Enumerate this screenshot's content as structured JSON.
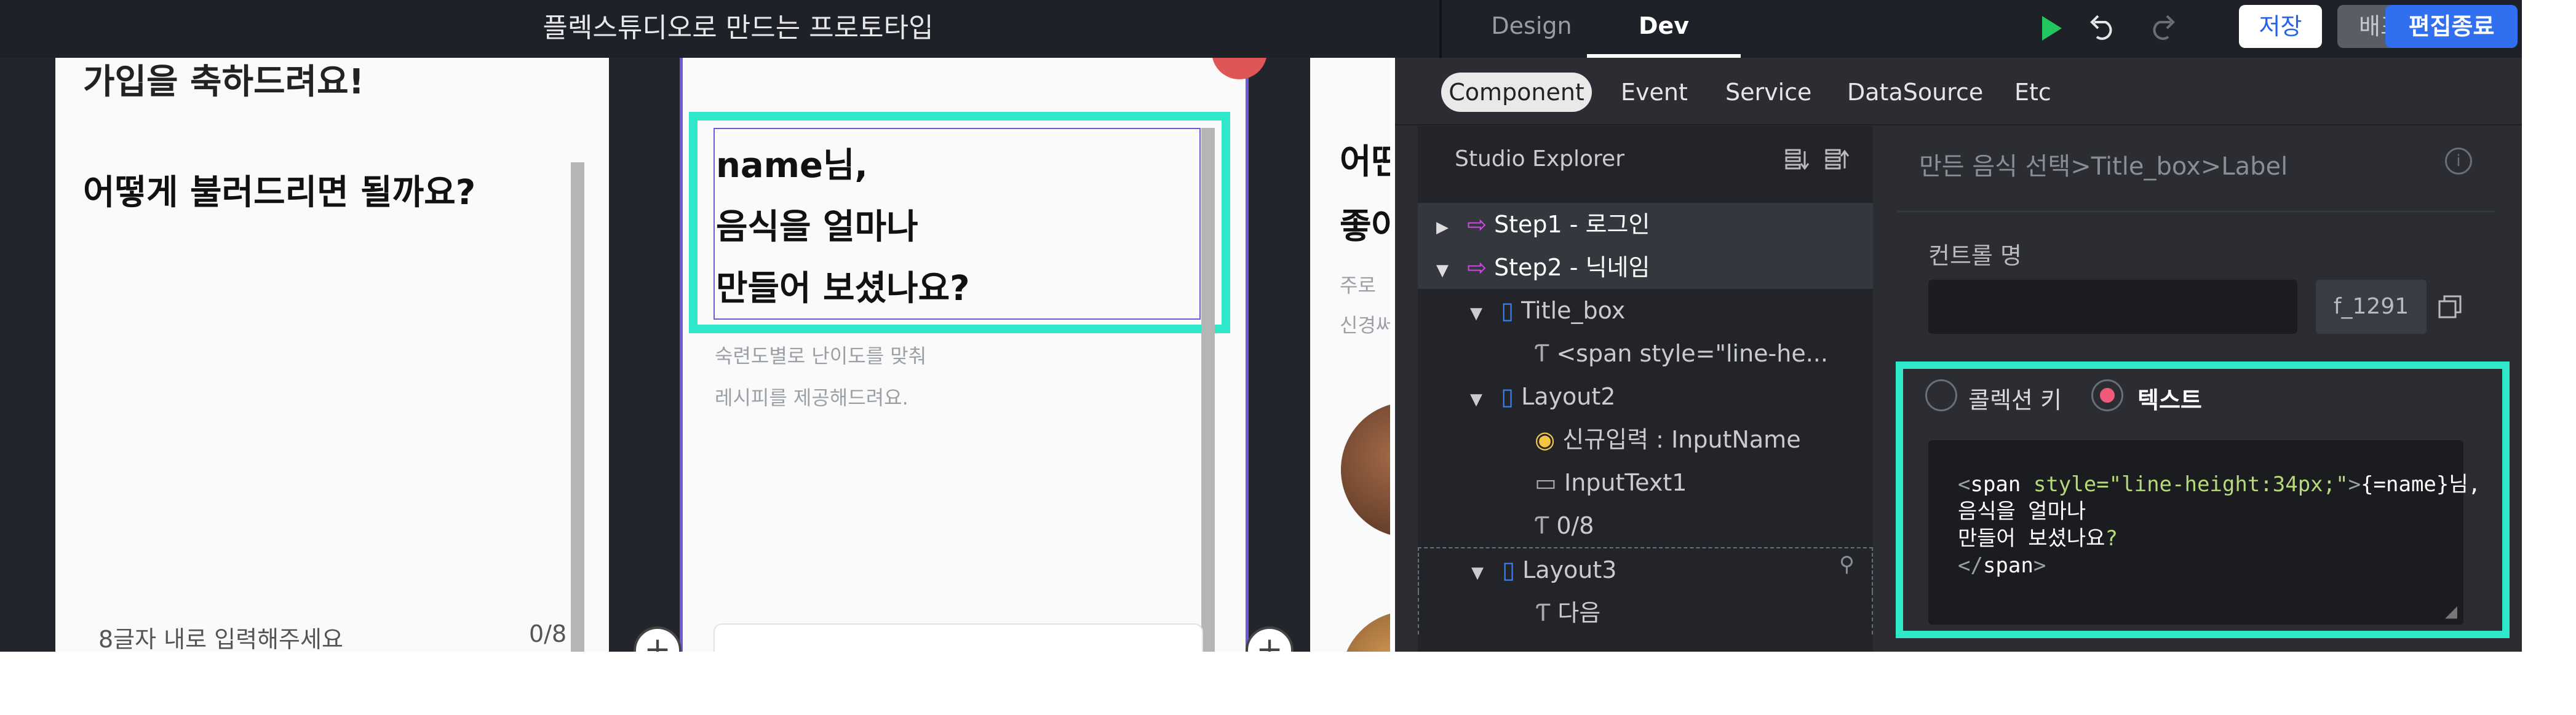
{
  "app": {
    "title": "플렉스튜디오로 만드는 프로토타입",
    "tabs": [
      "Design",
      "Dev"
    ],
    "active_tab": "Dev",
    "buttons": {
      "save": "저장",
      "deploy": "배포",
      "end_edit": "편집종료"
    }
  },
  "canvas": {
    "screen1": {
      "partial_line": "가입을 축하드려요!",
      "question": "어떻게 불러드리면 될까요?",
      "input_placeholder": "8글자 내로 입력해주세요",
      "counter": "0/8"
    },
    "screen2": {
      "label_lines": [
        "name님,",
        "음식을 얼마나",
        "만들어 보셨나요?"
      ],
      "sub_lines": [
        "숙련도별로 난이도를 맞춰",
        "레시피를 제공해드려요."
      ]
    },
    "screen3": {
      "title_fragments": [
        "어떤",
        "좋아"
      ],
      "sub_fragments": [
        "주로 ",
        "신경써"
      ]
    }
  },
  "dev": {
    "subtabs": [
      "Component",
      "Event",
      "Service",
      "DataSource",
      "Etc"
    ],
    "active_subtab": "Component",
    "explorer": {
      "title": "Studio Explorer",
      "items": [
        {
          "label": "Step1 - 로그인",
          "icon": "page-icon",
          "expanded": false,
          "indent": 0
        },
        {
          "label": "Step2 - 닉네임",
          "icon": "page-icon",
          "expanded": true,
          "indent": 0
        },
        {
          "label": "Title_box",
          "icon": "file-icon",
          "expanded": true,
          "indent": 1
        },
        {
          "label": "<span style=\"line-he...",
          "icon": "text-icon",
          "indent": 2
        },
        {
          "label": "Layout2",
          "icon": "file-icon",
          "expanded": true,
          "indent": 1
        },
        {
          "label": "신규입력 : InputName",
          "icon": "database-icon",
          "indent": 2
        },
        {
          "label": "InputText1",
          "icon": "input-icon",
          "indent": 2
        },
        {
          "label": "0/8",
          "icon": "text-icon",
          "indent": 2
        },
        {
          "label": "Layout3",
          "icon": "file-icon",
          "expanded": true,
          "indent": 1
        },
        {
          "label": "다음",
          "icon": "text-icon",
          "indent": 2
        }
      ]
    },
    "properties": {
      "breadcrumb": "만든 음식 선택>Title_box>Label",
      "control_name_label": "컨트롤 명",
      "control_name_value": "",
      "control_id": "f_1291",
      "radio": {
        "options": [
          "콜렉션 키",
          "텍스트"
        ],
        "selected": "텍스트"
      },
      "code_lines": [
        [
          {
            "t": "<",
            "c": "tag"
          },
          {
            "t": "span",
            "c": "text"
          },
          {
            "t": " style=\"line-height:34px;\"",
            "c": "attr"
          },
          {
            "t": ">",
            "c": "tag"
          },
          {
            "t": "{=name}님,",
            "c": "text"
          }
        ],
        [
          {
            "t": "음식을 얼마나",
            "c": "text"
          }
        ],
        [
          {
            "t": "만들어 보셨나요",
            "c": "text"
          },
          {
            "t": "?",
            "c": "attr"
          }
        ],
        [
          {
            "t": "</",
            "c": "tag"
          },
          {
            "t": "span",
            "c": "text"
          },
          {
            "t": ">",
            "c": "tag"
          }
        ]
      ]
    }
  },
  "colors": {
    "highlight": "#2ee8c9",
    "selection": "#6f5ad6",
    "accent_blue": "#2f6ff0",
    "code_attr": "#b6d97a",
    "code_tag": "#9aa0a6"
  }
}
